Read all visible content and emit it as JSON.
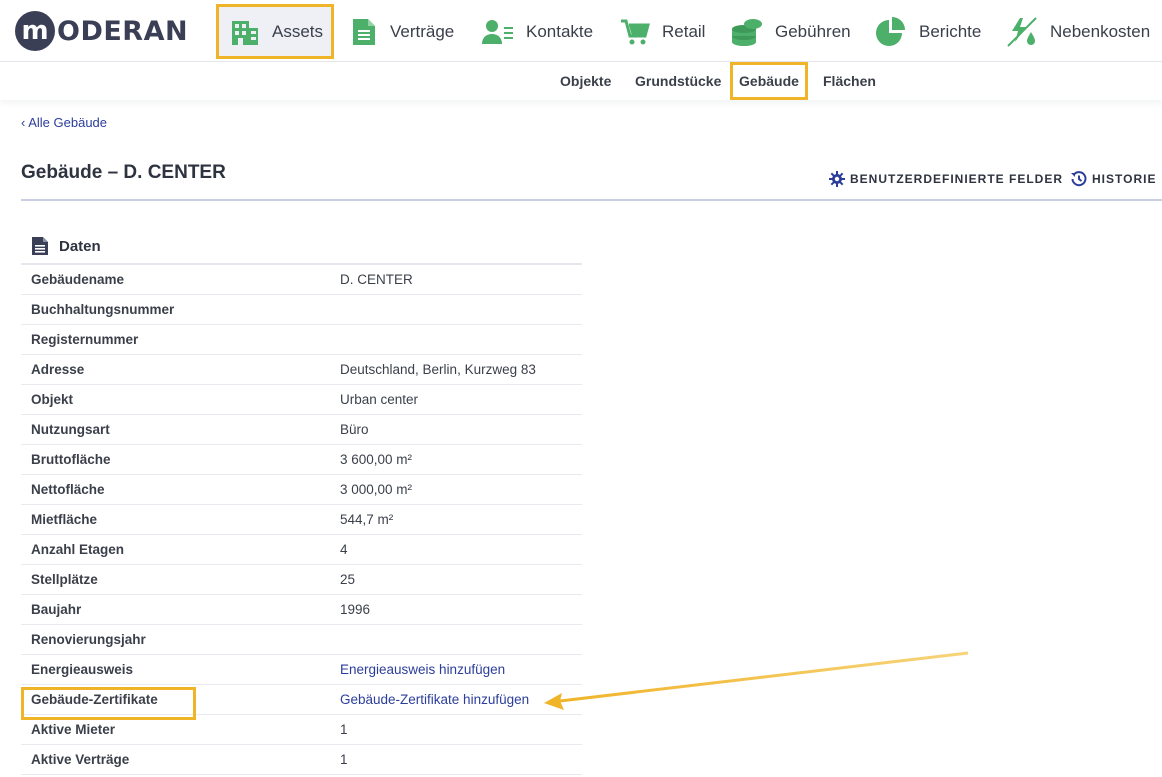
{
  "brand": {
    "logo_letter": "m",
    "logo_text": "ODERAN"
  },
  "nav": {
    "items": [
      {
        "label": "Assets"
      },
      {
        "label": "Verträge"
      },
      {
        "label": "Kontakte"
      },
      {
        "label": "Retail"
      },
      {
        "label": "Gebühren"
      },
      {
        "label": "Berichte"
      },
      {
        "label": "Nebenkosten"
      }
    ]
  },
  "subnav": {
    "items": [
      {
        "label": "Objekte"
      },
      {
        "label": "Grundstücke"
      },
      {
        "label": "Gebäude"
      },
      {
        "label": "Flächen"
      }
    ]
  },
  "breadcrumb": {
    "back": "‹ Alle Gebäude"
  },
  "header": {
    "title": "Gebäude – D. CENTER",
    "custom_fields": "BENUTZERDEFINIERTE FELDER",
    "history": "HISTORIE"
  },
  "section": {
    "title": "Daten",
    "rows": [
      {
        "label": "Gebäudename",
        "value": "D. CENTER"
      },
      {
        "label": "Buchhaltungsnummer",
        "value": ""
      },
      {
        "label": "Registernummer",
        "value": ""
      },
      {
        "label": "Adresse",
        "value": "Deutschland, Berlin, Kurzweg 83"
      },
      {
        "label": "Objekt",
        "value": "Urban center"
      },
      {
        "label": "Nutzungsart",
        "value": "Büro"
      },
      {
        "label": "Bruttofläche",
        "value": "3 600,00 m²"
      },
      {
        "label": "Nettofläche",
        "value": "3 000,00 m²"
      },
      {
        "label": "Mietfläche",
        "value": "544,7 m²"
      },
      {
        "label": "Anzahl Etagen",
        "value": "4"
      },
      {
        "label": "Stellplätze",
        "value": "25"
      },
      {
        "label": "Baujahr",
        "value": "1996"
      },
      {
        "label": "Renovierungsjahr",
        "value": ""
      },
      {
        "label": "Energieausweis",
        "value": "Energieausweis hinzufügen"
      },
      {
        "label": "Gebäude-Zertifikate",
        "value": "Gebäude-Zertifikate hinzufügen"
      },
      {
        "label": "Aktive Mieter",
        "value": "1"
      },
      {
        "label": "Aktive Verträge",
        "value": "1"
      }
    ]
  },
  "colors": {
    "accent": "#f0b429",
    "icon_green": "#4caf6a",
    "link": "#2c3e9a",
    "brand_dark": "#3b3f55"
  }
}
